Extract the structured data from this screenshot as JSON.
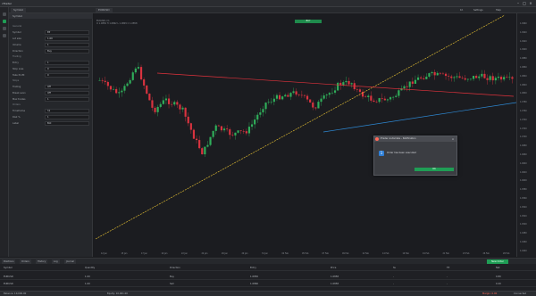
{
  "window": {
    "title": "cTrader"
  },
  "panel": {
    "title": "Symbol",
    "sections": [
      "General",
      "Trading",
      "Stops",
      "Orders"
    ],
    "rows": [
      {
        "label": "Symbol",
        "value": "EP"
      },
      {
        "label": "Lot size",
        "value": "1.00"
      },
      {
        "label": "Volume",
        "value": "1"
      },
      {
        "label": "Direction",
        "value": "Buy"
      },
      {
        "label": "Entry",
        "value": "1"
      },
      {
        "label": "Stop Loss",
        "value": "0"
      },
      {
        "label": "Take Profit",
        "value": "0"
      },
      {
        "label": "Trailing",
        "value": "Off"
      },
      {
        "label": "Break even",
        "value": "Off"
      },
      {
        "label": "Max trades",
        "value": "1"
      },
      {
        "label": "Timeframe",
        "value": "h1"
      },
      {
        "label": "Risk %",
        "value": "1"
      },
      {
        "label": "Label",
        "value": "Bot"
      }
    ]
  },
  "topstrip": {
    "tabs": [
      "Symbol",
      "EURUSD"
    ],
    "right_items": [
      "1h",
      "Settings",
      "Help"
    ]
  },
  "chart": {
    "info_lines": [
      "EURUSD, h1",
      "O 1.0850 H 1.0862 L 1.0845 C 1.0858"
    ],
    "badge": "BUY",
    "price_ticks": [
      "1.0960",
      "1.0940",
      "1.0920",
      "1.0900",
      "1.0880",
      "1.0860",
      "1.0840",
      "1.0820",
      "1.0800",
      "1.0780",
      "1.0760",
      "1.0740",
      "1.0720",
      "1.0700",
      "1.0680",
      "1.0660",
      "1.0640",
      "1.0620",
      "1.0600",
      "1.0580",
      "1.0560",
      "1.0540",
      "1.0520",
      "1.0500",
      "1.0480",
      "1.0460",
      "1.0440"
    ],
    "time_ticks": [
      "12 Jan",
      "15 Jan",
      "17 Jan",
      "19 Jan",
      "22 Jan",
      "24 Jan",
      "26 Jan",
      "29 Jan",
      "31 Jan",
      "02 Feb",
      "05 Feb",
      "07 Feb",
      "09 Feb",
      "12 Feb",
      "14 Feb",
      "16 Feb",
      "19 Feb",
      "21 Feb",
      "23 Feb",
      "26 Feb",
      "28 Feb"
    ],
    "colors": {
      "up": "#2fae5a",
      "down": "#d9333f",
      "trend_red": "#e0323c",
      "trend_blue": "#2e8ad6",
      "trend_yellow": "#d6b431"
    }
  },
  "dialog": {
    "title": "cTrader Automate - Notification",
    "badge": "1",
    "message": "Order has been executed",
    "ok_label": "OK"
  },
  "bottom": {
    "tabs": [
      "Positions",
      "Orders",
      "History",
      "Log",
      "Journal"
    ],
    "new_order_label": "New Order",
    "header": [
      "Symbol",
      "Quantity",
      "Direction",
      "Entry",
      "Price",
      "SL",
      "TP",
      "Net"
    ],
    "rows": [
      [
        "EURUSD",
        "1.00",
        "Buy",
        "1.0850",
        "1.0858",
        "-",
        "-",
        "0.80"
      ],
      [
        "EURUSD",
        "1.00",
        "Sell",
        "1.0860",
        "1.0858",
        "-",
        "-",
        "0.20"
      ]
    ]
  },
  "status": {
    "left": "Balance: 10,000.00",
    "mid": "Equity: 10,001.00",
    "red": "Margin: 0.00",
    "right": "Connected"
  }
}
